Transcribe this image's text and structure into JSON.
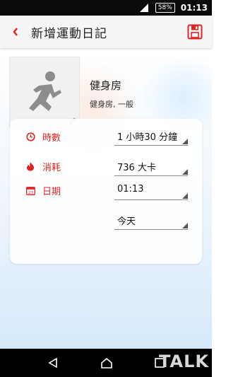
{
  "status_bar": {
    "battery": "58%",
    "time": "01:13"
  },
  "app_bar": {
    "title": "新增運動日記"
  },
  "activity": {
    "name": "健身房",
    "subtitle": "健身房, 一般"
  },
  "form": {
    "duration": {
      "label": "時數",
      "value": "1 小時30 分鐘"
    },
    "calories": {
      "label": "消耗",
      "value": "736 大卡"
    },
    "date": {
      "label": "日期",
      "value": "01:13"
    },
    "day": {
      "value": "今天"
    },
    "calendar_icon_day": "23"
  },
  "watermark": "TALK",
  "colors": {
    "accent": "#e02424",
    "background_top": "#ffffff",
    "background_bottom": "#d6eafb"
  }
}
